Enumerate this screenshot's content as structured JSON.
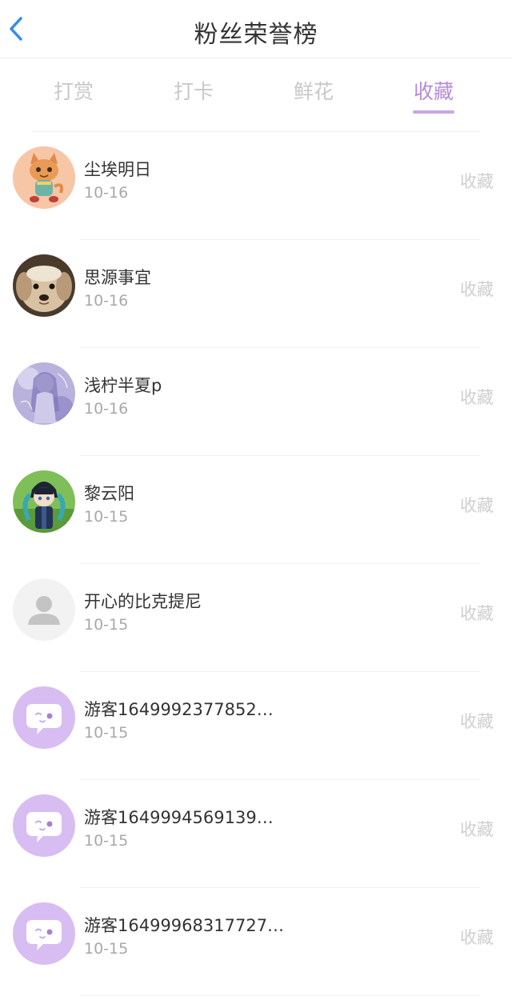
{
  "header": {
    "title": "粉丝荣誉榜",
    "back_icon": "chevron-left-icon"
  },
  "tabs": [
    {
      "label": "打赏",
      "active": false
    },
    {
      "label": "打卡",
      "active": false
    },
    {
      "label": "鲜花",
      "active": false
    },
    {
      "label": "收藏",
      "active": true
    }
  ],
  "colors": {
    "accent": "#b98ad6",
    "back_icon": "#2f8cf0",
    "inactive_tab": "#c8c8c8",
    "guest_avatar_bg": "#d8bdf2"
  },
  "list": [
    {
      "name": "尘埃明日",
      "date": "10-16",
      "action": "收藏",
      "avatar": "cartoon-cat-avatar"
    },
    {
      "name": "思源事宜",
      "date": "10-16",
      "action": "收藏",
      "avatar": "dog-photo-avatar"
    },
    {
      "name": "浅柠半夏p",
      "date": "10-16",
      "action": "收藏",
      "avatar": "anime-illustration-avatar"
    },
    {
      "name": "黎云阳",
      "date": "10-15",
      "action": "收藏",
      "avatar": "anime-character-avatar"
    },
    {
      "name": "开心的比克提尼",
      "date": "10-15",
      "action": "收藏",
      "avatar": "default-user-avatar"
    },
    {
      "name": "游客1649992377852…",
      "date": "10-15",
      "action": "收藏",
      "avatar": "guest-chat-avatar"
    },
    {
      "name": "游客1649994569139…",
      "date": "10-15",
      "action": "收藏",
      "avatar": "guest-chat-avatar"
    },
    {
      "name": "游客16499968317727…",
      "date": "10-15",
      "action": "收藏",
      "avatar": "guest-chat-avatar"
    }
  ]
}
